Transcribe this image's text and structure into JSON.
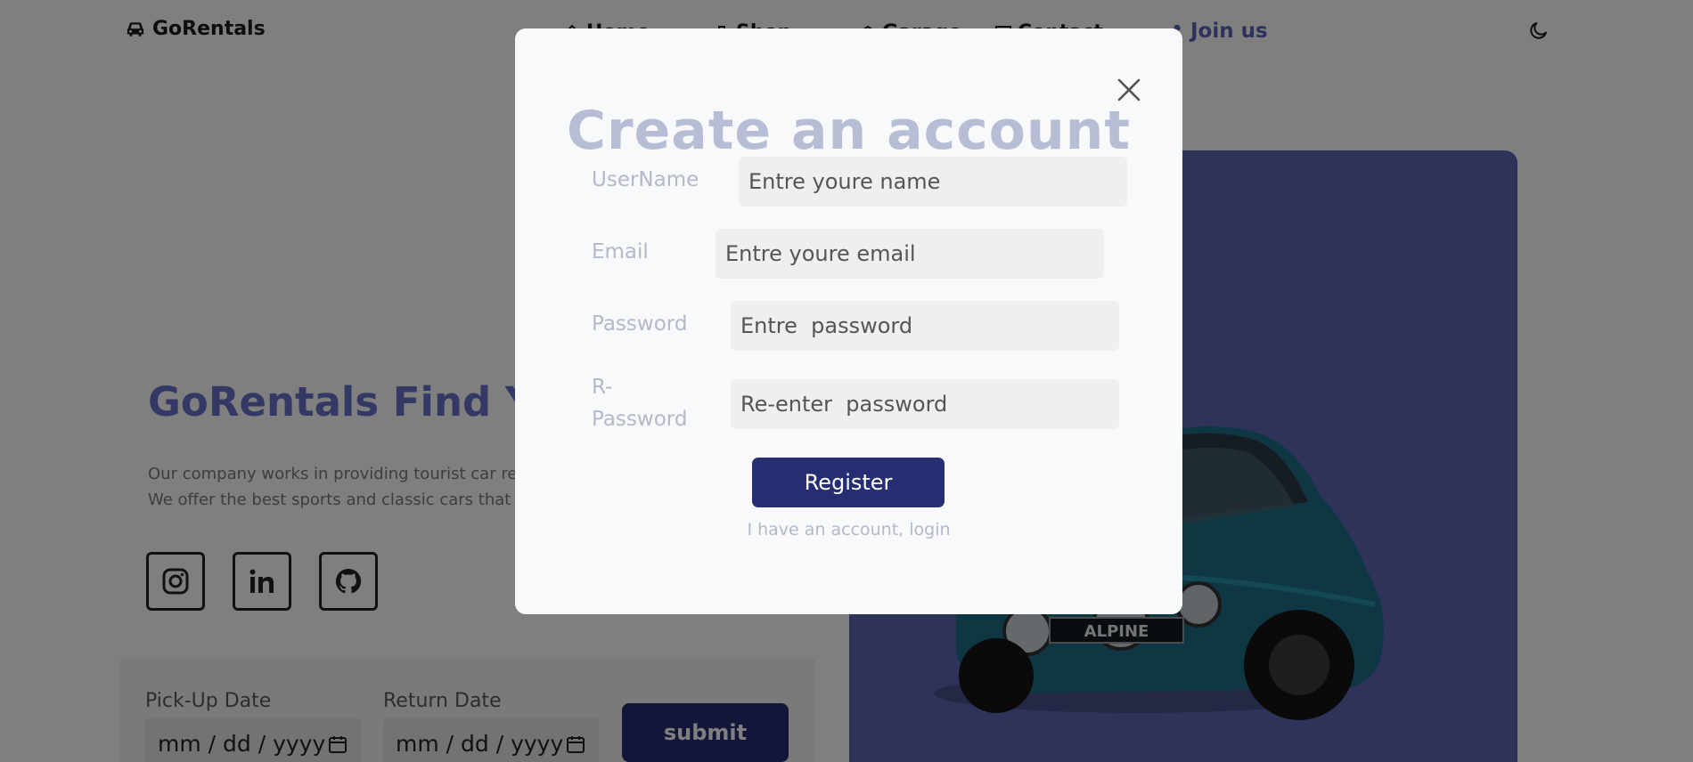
{
  "navbar": {
    "brand": "GoRentals",
    "links": [
      "Home",
      "Shop",
      "Garage",
      "Contact"
    ],
    "join_label": "Join us"
  },
  "hero": {
    "title": "GoRentals Find Your",
    "description_lines": [
      "Our company works in providing tourist car re",
      "We offer the best sports and classic cars that"
    ]
  },
  "social": [
    "instagram-icon",
    "linkedin-icon",
    "github-icon"
  ],
  "booking": {
    "pickup_label": "Pick-Up Date",
    "return_label": "Return Date",
    "date_placeholder": "mm / dd / yyyy",
    "submit_label": "submit"
  },
  "modal": {
    "title": "Create an account",
    "fields": [
      {
        "label": "UserName",
        "placeholder": "Entre youre name"
      },
      {
        "label": "Email",
        "placeholder": "Entre youre email"
      },
      {
        "label": "Password",
        "placeholder": "Entre  password"
      },
      {
        "label_line1": "R-",
        "label_line2": "Password",
        "placeholder": "Re-enter  password"
      }
    ],
    "register_label": "Register",
    "login_link": "I have an account, login"
  },
  "car": {
    "plate": "ALPINE"
  },
  "colors": {
    "accent": "#252e72",
    "brand_blue": "#6870c8",
    "panel": "#5e67b4",
    "modal_bg": "#f8f9fb"
  }
}
